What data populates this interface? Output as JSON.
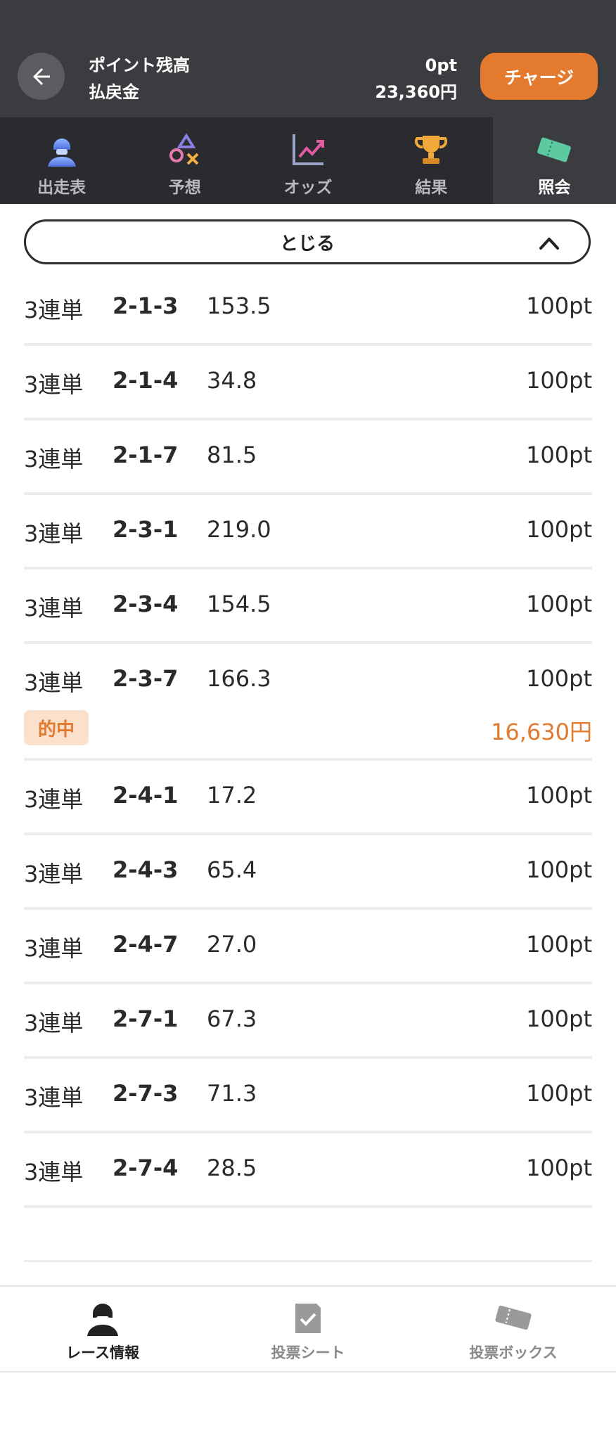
{
  "header": {
    "point_label": "ポイント残高",
    "payout_label": "払戻金",
    "point_value": "0pt",
    "payout_value": "23,360円",
    "charge_label": "チャージ"
  },
  "tabs": [
    {
      "label": "出走表",
      "icon": "racer-icon"
    },
    {
      "label": "予想",
      "icon": "prediction-icon"
    },
    {
      "label": "オッズ",
      "icon": "odds-chart-icon"
    },
    {
      "label": "結果",
      "icon": "trophy-icon"
    },
    {
      "label": "照会",
      "icon": "ticket-icon",
      "active": true
    }
  ],
  "collapse_label": "とじる",
  "bets": [
    {
      "type": "3連単",
      "combo": "2-1-3",
      "odds": "153.5",
      "amount": "100pt"
    },
    {
      "type": "3連単",
      "combo": "2-1-4",
      "odds": "34.8",
      "amount": "100pt"
    },
    {
      "type": "3連単",
      "combo": "2-1-7",
      "odds": "81.5",
      "amount": "100pt"
    },
    {
      "type": "3連単",
      "combo": "2-3-1",
      "odds": "219.0",
      "amount": "100pt"
    },
    {
      "type": "3連単",
      "combo": "2-3-4",
      "odds": "154.5",
      "amount": "100pt"
    },
    {
      "type": "3連単",
      "combo": "2-3-7",
      "odds": "166.3",
      "amount": "100pt",
      "hit_label": "的中",
      "payout": "16,630円"
    },
    {
      "type": "3連単",
      "combo": "2-4-1",
      "odds": "17.2",
      "amount": "100pt"
    },
    {
      "type": "3連単",
      "combo": "2-4-3",
      "odds": "65.4",
      "amount": "100pt"
    },
    {
      "type": "3連単",
      "combo": "2-4-7",
      "odds": "27.0",
      "amount": "100pt"
    },
    {
      "type": "3連単",
      "combo": "2-7-1",
      "odds": "67.3",
      "amount": "100pt"
    },
    {
      "type": "3連単",
      "combo": "2-7-3",
      "odds": "71.3",
      "amount": "100pt"
    },
    {
      "type": "3連単",
      "combo": "2-7-4",
      "odds": "28.5",
      "amount": "100pt"
    }
  ],
  "bottom_nav": [
    {
      "label": "レース情報",
      "icon": "racer-icon",
      "active": true
    },
    {
      "label": "投票シート",
      "icon": "vote-sheet-icon"
    },
    {
      "label": "投票ボックス",
      "icon": "ticket-icon"
    }
  ],
  "colors": {
    "accent": "#e37a2e",
    "header_bg": "#3b3c40",
    "tab_bg": "#2a2b2f",
    "hit_bg": "#fbe0cc"
  }
}
